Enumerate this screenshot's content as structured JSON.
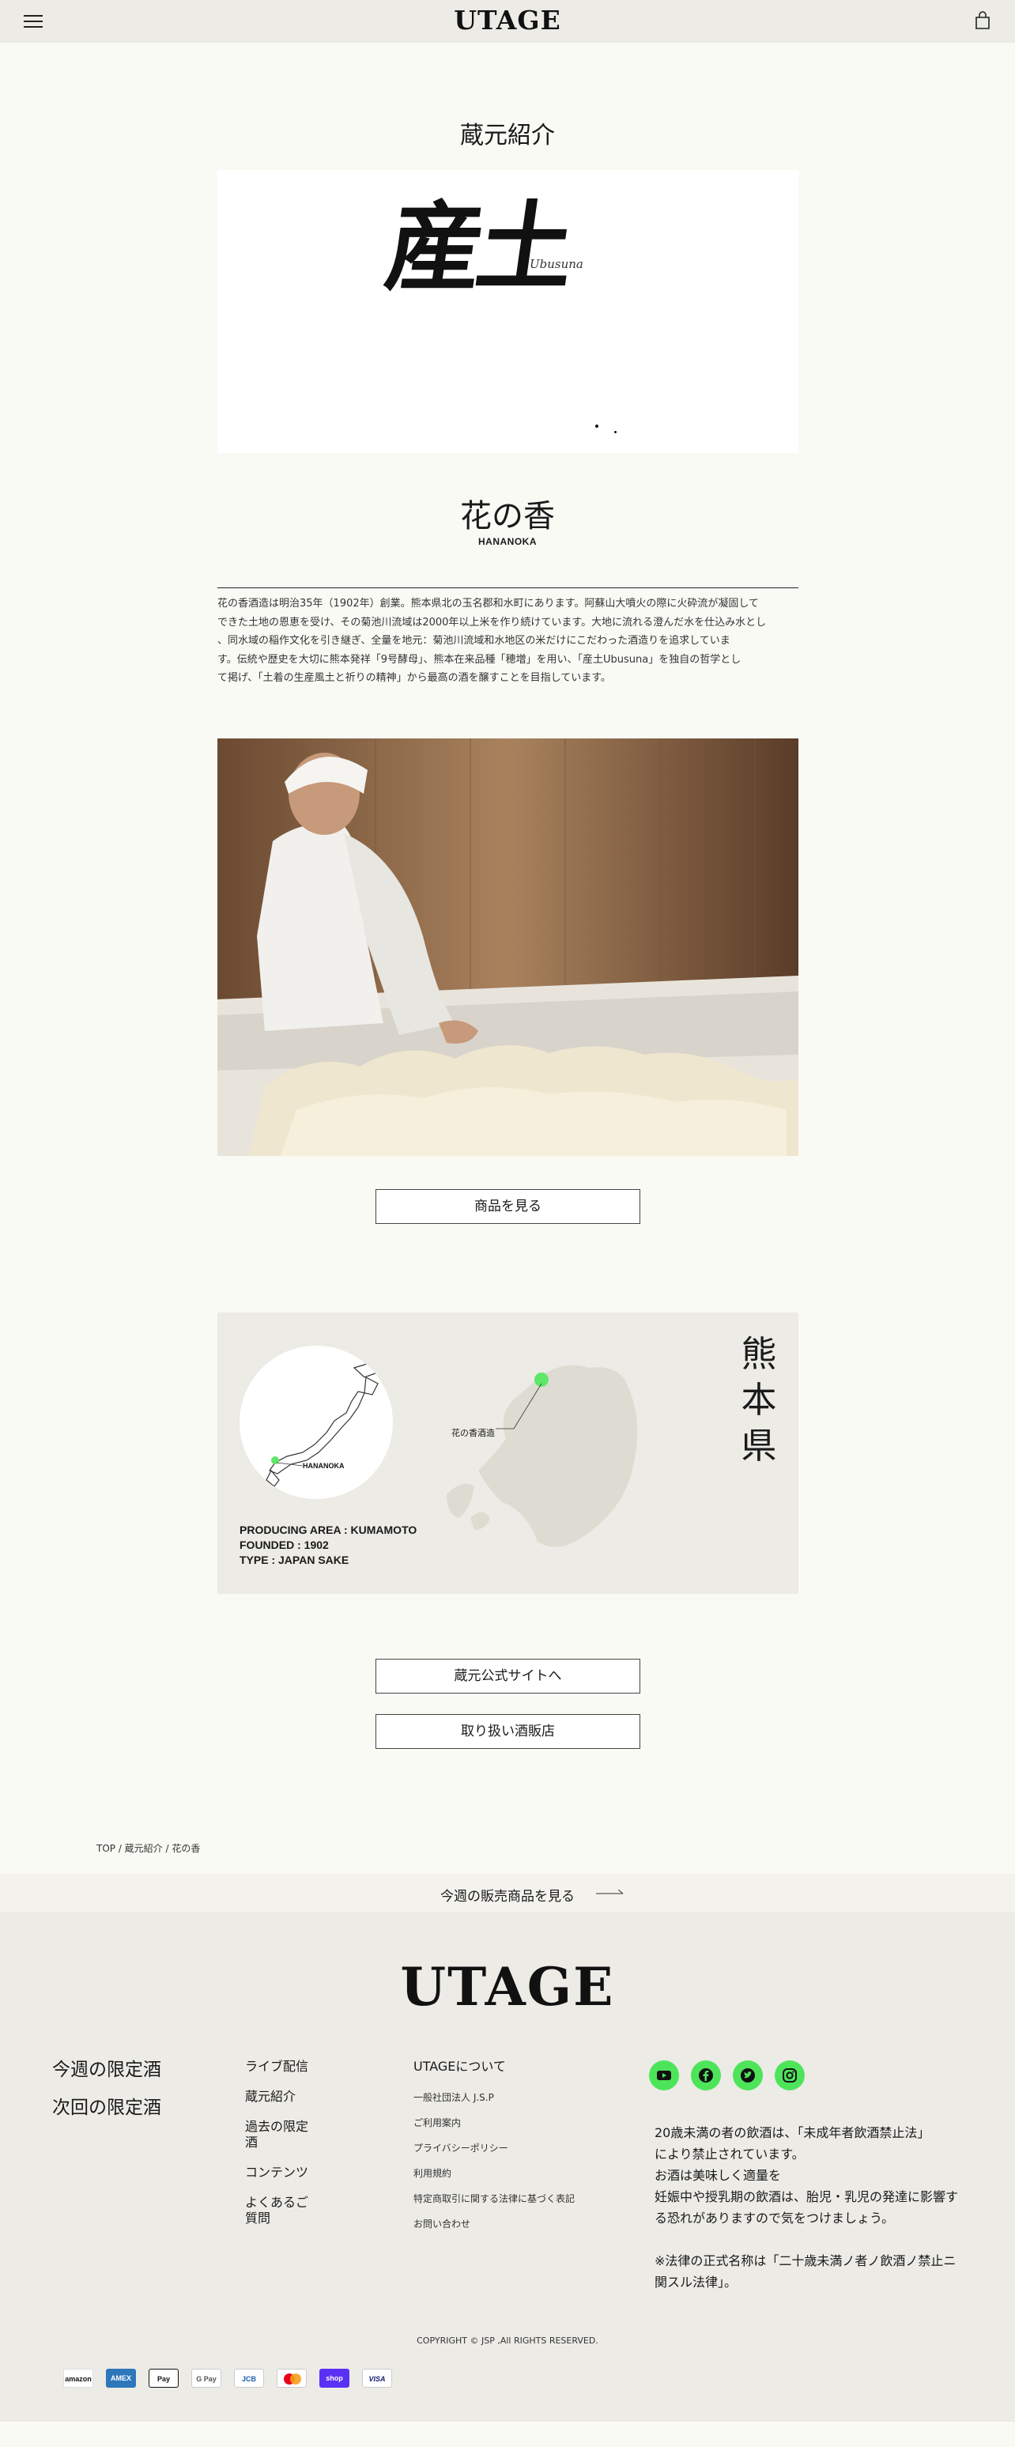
{
  "header": {
    "logo": "UTAGE",
    "menu_icon": "hamburger-icon",
    "cart_icon": "bag-icon"
  },
  "page_title": "蔵元紹介",
  "brewery": {
    "calligraphy": "産土",
    "calligraphy_sub": "Ubusuna",
    "name": "花の香",
    "name_roman": "HANANOKA",
    "description_lines": [
      "花の香酒造は明治35年（1902年）創業。熊本県北の玉名郡和水町にあります。阿蘇山大噴火の際に火砕流が凝固して",
      "できた土地の恩恵を受け、その菊池川流域は2000年以上米を作り続けています。大地に流れる澄んだ水を仕込み水とし",
      "、同水域の稲作文化を引き継ぎ、全量を地元：菊池川流域和水地区の米だけにこだわった酒造りを追求していま",
      "す。伝統や歴史を大切に熊本発祥「9号酵母」、熊本在来品種「穂増」を用い、「産土Ubusuna」を独自の哲学とし",
      "て掲げ、「土着の生産風土と祈りの精神」から最高の酒を醸すことを目指しています。"
    ]
  },
  "buttons": {
    "products": "商品を見る",
    "official_site": "蔵元公式サイトへ",
    "retailers": "取り扱い酒販店"
  },
  "map": {
    "circle_label": "HANANOKA",
    "marker_label": "花の香酒造",
    "prefecture_chars": [
      "熊",
      "本",
      "県"
    ],
    "info": [
      "PRODUCING AREA : KUMAMOTO",
      "FOUNDED : 1902",
      "TYPE : JAPAN SAKE"
    ],
    "marker_color": "#5ee86a"
  },
  "breadcrumb": "TOP / 蔵元紹介 / 花の香",
  "week_link": "今週の販売商品を見る",
  "footer": {
    "logo": "UTAGE",
    "col1": [
      "今週の限定酒",
      "次回の限定酒"
    ],
    "col2": [
      "ライブ配信",
      "蔵元紹介",
      "過去の限定酒",
      "コンテンツ",
      "よくあるご質問"
    ],
    "col3_title": "UTAGEについて",
    "col3": [
      "一般社団法人 J.S.P",
      "ご利用案内",
      "プライバシーポリシー",
      "利用規約",
      "特定商取引に関する法律に基づく表記",
      "お問い合わせ"
    ],
    "social": [
      "youtube-icon",
      "facebook-icon",
      "twitter-icon",
      "instagram-icon"
    ],
    "social_color": "#4ee45a",
    "legal_lines": [
      "20歳未満の者の飲酒は、「未成年者飲酒禁止法」",
      "により禁止されています。",
      "お酒は美味しく適量を",
      "妊娠中や授乳期の飲酒は、胎児・乳児の発達に影響す",
      "る恐れがありますので気をつけましょう。",
      "",
      "※法律の正式名称は「二十歳未満ノ者ノ飲酒ノ禁止ニ",
      "関スル法律」。"
    ],
    "copyright": "COPYRIGHT © JSP ,All RIGHTS RESERVED.",
    "payments": [
      "amazon",
      "AMEX",
      "Pay",
      "G Pay",
      "JCB",
      "mastercard",
      "shop",
      "VISA"
    ]
  }
}
